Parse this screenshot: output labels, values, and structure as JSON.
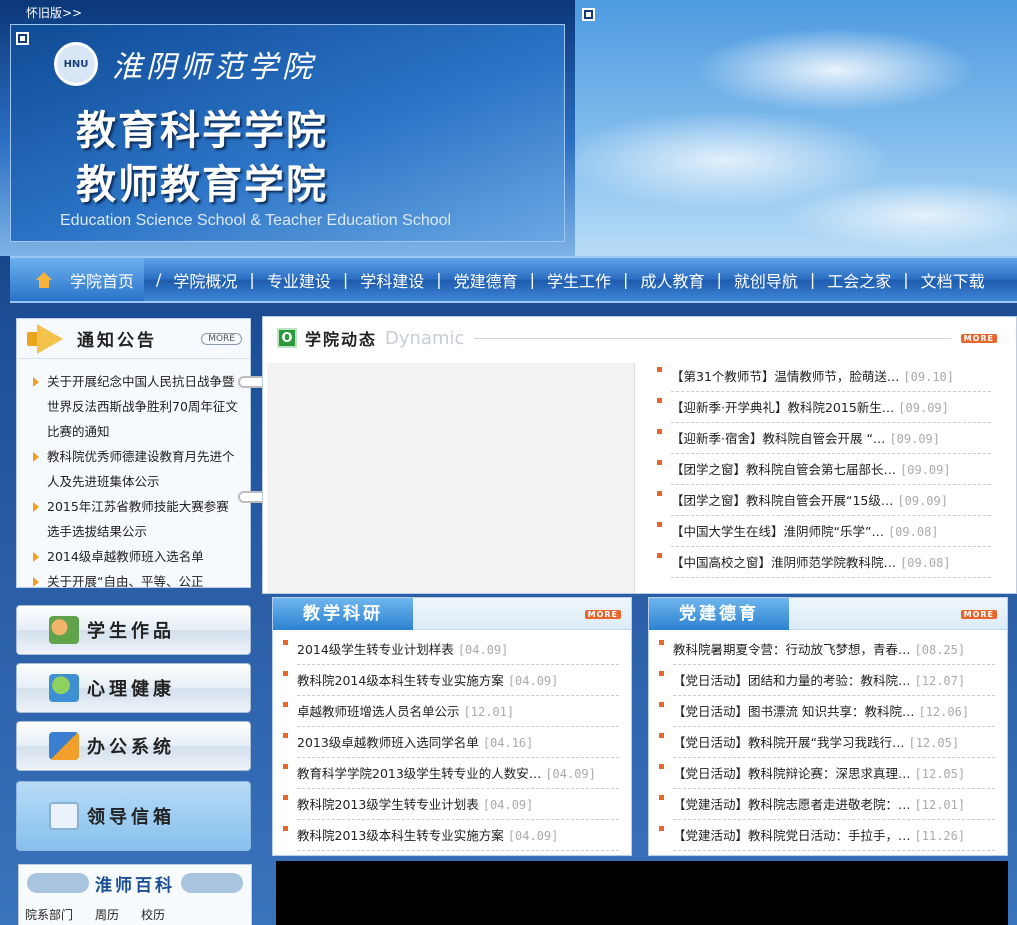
{
  "header": {
    "old_version": "怀旧版>>",
    "school_name": "淮阴师范学院",
    "seal_text": "HNU",
    "title_line1": "教育科学学院",
    "title_line2": "教师教育学院",
    "title_en": "Education Science School & Teacher Education School"
  },
  "nav": {
    "home": "学院首页",
    "items": [
      "学院概况",
      "专业建设",
      "学科建设",
      "党建德育",
      "学生工作",
      "成人教育",
      "就创导航",
      "工会之家",
      "文档下载"
    ]
  },
  "notice": {
    "title": "通知公告",
    "more": "MORE",
    "items": [
      "关于开展纪念中国人民抗日战争暨 世界反法西斯战争胜利70周年征文比赛的通知",
      "教科院优秀师德建设教育月先进个人及先进班集体公示",
      "2015年江苏省教师技能大赛参赛选手选拔结果公示",
      "2014级卓越教师班入选名单",
      "关于开展“自由、平等、公正"
    ]
  },
  "sidebar_buttons": {
    "works": "学生作品",
    "health": "心理健康",
    "office": "办公系统",
    "leader": "领导信箱"
  },
  "wiki": {
    "title": "淮师百科",
    "links": [
      "院系部门",
      "周历",
      "校历"
    ]
  },
  "dynamic": {
    "tag": "O",
    "title": "学院动态",
    "title_en": "Dynamic",
    "more": "MORE",
    "items": [
      {
        "text": "【第31个教师节】温情教师节，脸萌送…",
        "date": "[09.10]"
      },
      {
        "text": "【迎新季·开学典礼】教科院2015新生…",
        "date": "[09.09]"
      },
      {
        "text": "【迎新季·宿舍】教科院自管会开展 “…",
        "date": "[09.09]"
      },
      {
        "text": "【团学之窗】教科院自管会第七届部长…",
        "date": "[09.09]"
      },
      {
        "text": "【团学之窗】教科院自管会开展“15级…",
        "date": "[09.09]"
      },
      {
        "text": "【中国大学生在线】淮阴师院“乐学”…",
        "date": "[09.08]"
      },
      {
        "text": "【中国高校之窗】淮阴师范学院教科院…",
        "date": "[09.08]"
      }
    ]
  },
  "research": {
    "title": "教学科研",
    "more": "MORE",
    "items": [
      {
        "text": "2014级学生转专业计划样表",
        "date": "[04.09]"
      },
      {
        "text": "教科院2014级本科生转专业实施方案",
        "date": "[04.09]"
      },
      {
        "text": "卓越教师班增选人员名单公示",
        "date": "[12.01]"
      },
      {
        "text": "2013级卓越教师班入选同学名单",
        "date": "[04.16]"
      },
      {
        "text": "教育科学学院2013级学生转专业的人数安…",
        "date": "[04.09]"
      },
      {
        "text": "教科院2013级学生转专业计划表",
        "date": "[04.09]"
      },
      {
        "text": "教科院2013级本科生转专业实施方案",
        "date": "[04.09]"
      }
    ]
  },
  "party": {
    "title": "党建德育",
    "more": "MORE",
    "items": [
      {
        "text": "教科院暑期夏令营：行动放飞梦想，青春…",
        "date": "[08.25]"
      },
      {
        "text": "【党日活动】团结和力量的考验：教科院…",
        "date": "[12.07]"
      },
      {
        "text": "【党日活动】图书漂流 知识共享：教科院…",
        "date": "[12.06]"
      },
      {
        "text": "【党日活动】教科院开展“我学习我践行…",
        "date": "[12.05]"
      },
      {
        "text": "【党日活动】教科院辩论赛：深思求真理…",
        "date": "[12.05]"
      },
      {
        "text": "【党建活动】教科院志愿者走进敬老院：…",
        "date": "[12.01]"
      },
      {
        "text": "【党建活动】教科院党日活动：手拉手，…",
        "date": "[11.26]"
      }
    ]
  },
  "colors": {
    "nav_blue": "#2c6fc4",
    "accent_orange": "#e8652c",
    "bullet_yellow": "#f0a11b"
  }
}
